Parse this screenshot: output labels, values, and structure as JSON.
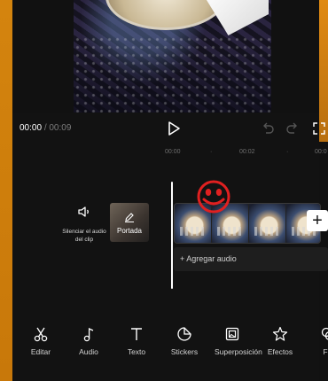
{
  "player": {
    "current_time": "00:00",
    "separator": "/",
    "total_time": "00:09"
  },
  "ruler": {
    "labels": [
      "00:00",
      "·",
      "00:02",
      "·",
      "00:0"
    ]
  },
  "track": {
    "mute_label": "Silenciar el audio del clip",
    "cover_label": "Portada",
    "add_audio_label": "+ Agregar audio",
    "add_clip_symbol": "+",
    "sticker": "red-smiley-sticker"
  },
  "toolbar": {
    "items": [
      {
        "label": "Editar",
        "icon": "scissors-icon"
      },
      {
        "label": "Audio",
        "icon": "music-note-icon"
      },
      {
        "label": "Texto",
        "icon": "text-icon"
      },
      {
        "label": "Stickers",
        "icon": "sticker-icon"
      },
      {
        "label": "Superposición",
        "icon": "overlay-icon"
      },
      {
        "label": "Efectos",
        "icon": "effects-star-icon"
      },
      {
        "label": "Filt",
        "icon": "filter-icon"
      }
    ]
  },
  "colors": {
    "background": "#121212",
    "accent_orange": "#e08a12",
    "sticker_red": "#e02020"
  }
}
